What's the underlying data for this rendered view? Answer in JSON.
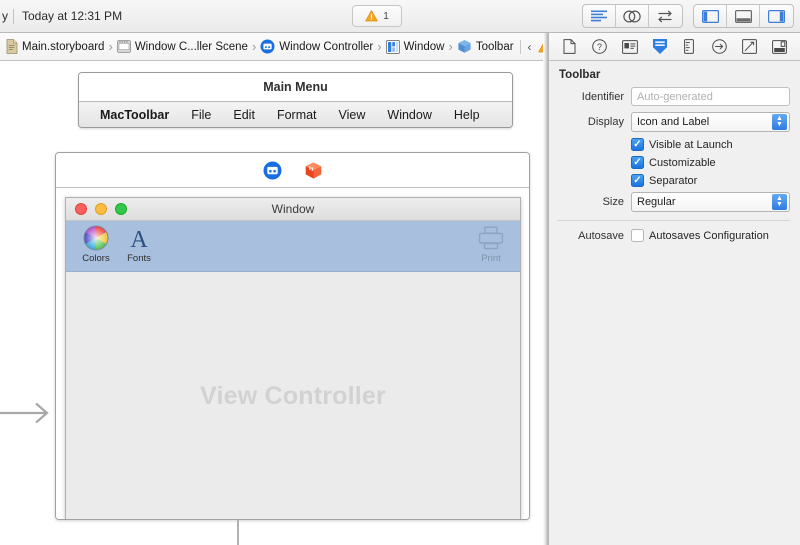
{
  "topbar": {
    "truncated_left_label": "y",
    "status_text": "Today at 12:31 PM",
    "warning_badge": {
      "icon": "warning-triangle-icon",
      "count": "1"
    },
    "editor_buttons": [
      {
        "name": "standard-editor-button",
        "icon": "standard-editor-icon"
      },
      {
        "name": "assistant-editor-button",
        "icon": "venn-circles-icon"
      },
      {
        "name": "version-editor-button",
        "icon": "arrows-swap-icon"
      }
    ],
    "view_buttons": [
      {
        "name": "toggle-navigator-button",
        "icon": "left-panel-icon"
      },
      {
        "name": "toggle-debug-area-button",
        "icon": "bottom-panel-icon"
      },
      {
        "name": "toggle-utilities-button",
        "icon": "right-panel-icon"
      }
    ],
    "accent_color": "#2f7de0",
    "warning_color": "#f5a623"
  },
  "jumpbar": {
    "crumbs": [
      {
        "label": "Main.storyboard",
        "icon": "storyboard-file-icon"
      },
      {
        "label": "Window C...ller Scene",
        "icon": "scene-icon"
      },
      {
        "label": "Window Controller",
        "icon": "window-controller-icon"
      },
      {
        "label": "Window",
        "icon": "window-icon"
      },
      {
        "label": "Toolbar",
        "icon": "toolbar-cube-icon"
      }
    ],
    "prev_issue": "‹",
    "next_issue": "›",
    "issue_icon": "warning-triangle-icon"
  },
  "canvas": {
    "main_menu": {
      "title": "Main Menu",
      "items": [
        "MacToolbar",
        "File",
        "Edit",
        "Format",
        "View",
        "Window",
        "Help"
      ]
    },
    "scene": {
      "dock_icons": [
        {
          "name": "window-controller-dock-icon",
          "color": "#1a6fe0"
        },
        {
          "name": "toolbar-cube-dock-icon",
          "color": "#f0562d"
        }
      ],
      "window": {
        "title": "Window",
        "traffic_lights": [
          "close",
          "minimize",
          "zoom"
        ],
        "toolbar_items": [
          {
            "label": "Colors",
            "icon": "color-wheel-icon",
            "dim": false
          },
          {
            "label": "Fonts",
            "icon": "font-a-icon",
            "dim": false
          },
          {
            "label": "Print",
            "icon": "printer-icon",
            "dim": true
          }
        ],
        "content_placeholder": "View Controller"
      }
    }
  },
  "inspector": {
    "tabs": [
      {
        "name": "file-inspector-tab",
        "icon": "document-icon",
        "selected": false
      },
      {
        "name": "quick-help-inspector-tab",
        "icon": "question-circle-icon",
        "selected": false
      },
      {
        "name": "identity-inspector-tab",
        "icon": "identity-card-icon",
        "selected": false
      },
      {
        "name": "attributes-inspector-tab",
        "icon": "attributes-shield-icon",
        "selected": true
      },
      {
        "name": "size-inspector-tab",
        "icon": "ruler-icon",
        "selected": false
      },
      {
        "name": "connections-inspector-tab",
        "icon": "arrow-circle-icon",
        "selected": false
      },
      {
        "name": "bindings-inspector-tab",
        "icon": "bindings-icon",
        "selected": false
      },
      {
        "name": "view-effects-inspector-tab",
        "icon": "view-effects-icon",
        "selected": false
      }
    ],
    "section_title": "Toolbar",
    "identifier": {
      "label": "Identifier",
      "value": "",
      "placeholder": "Auto-generated"
    },
    "display": {
      "label": "Display",
      "value": "Icon and Label"
    },
    "checkboxes": [
      {
        "label": "Visible at Launch",
        "checked": true
      },
      {
        "label": "Customizable",
        "checked": true
      },
      {
        "label": "Separator",
        "checked": true
      }
    ],
    "size": {
      "label": "Size",
      "value": "Regular"
    },
    "autosave": {
      "label": "Autosave",
      "checkbox_label": "Autosaves Configuration",
      "checked": false
    }
  }
}
